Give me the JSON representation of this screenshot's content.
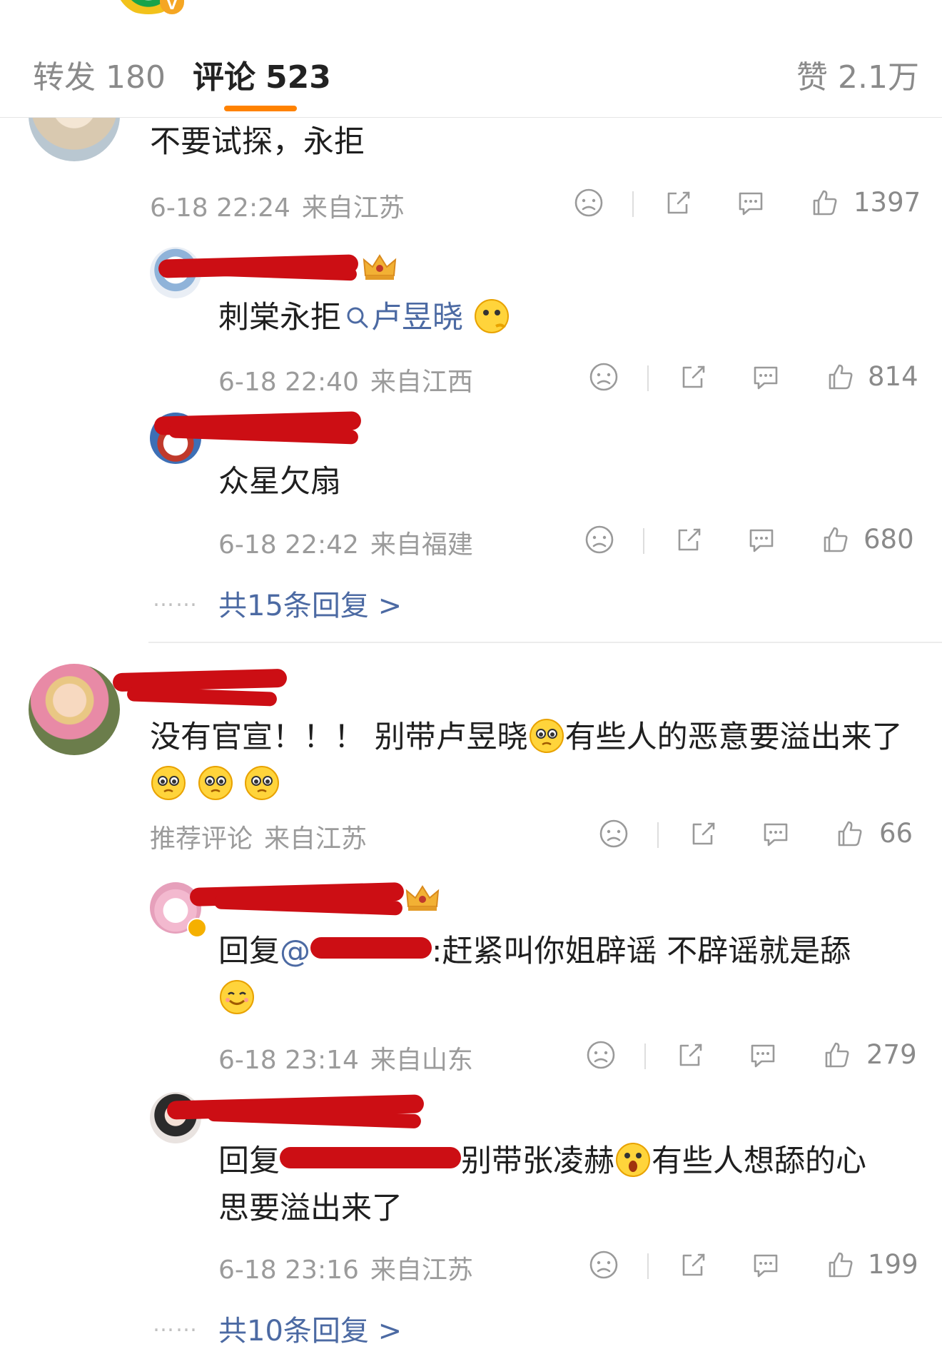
{
  "header": {
    "tabs": [
      {
        "label": "转发",
        "count": "180"
      },
      {
        "label": "评论",
        "count": "523"
      }
    ],
    "likes": {
      "label": "赞",
      "count": "2.1万"
    }
  },
  "comments": [
    {
      "text": "不要试探，永拒",
      "time": "6-18 22:24",
      "location": "来自江苏",
      "likes": "1397",
      "replies": [
        {
          "text_prefix": "刺棠永拒",
          "link": "卢昱晓",
          "time": "6-18 22:40",
          "location": "来自江西",
          "likes": "814"
        },
        {
          "text": "众星欠扇",
          "time": "6-18 22:42",
          "location": "来自福建",
          "likes": "680"
        }
      ],
      "more": "共15条回复 >"
    },
    {
      "text_line1": "没有官宣！！！ 别带卢昱晓",
      "text_line1_tail": "有些人的恶意要溢出来了",
      "tag": "推荐评论",
      "location": "来自江苏",
      "likes": "66",
      "replies": [
        {
          "prefix": "回复",
          "at": "@",
          "body": ":赶紧叫你姐辟谣 不辟谣就是舔",
          "time": "6-18 23:14",
          "location": "来自山东",
          "likes": "279"
        },
        {
          "prefix": "回复",
          "body": "别带张凌赫",
          "body_tail": "有些人想舔的心",
          "line2": "思要溢出来了",
          "time": "6-18 23:16",
          "location": "来自江苏",
          "likes": "199"
        }
      ],
      "more": "共10条回复 >"
    }
  ],
  "colors": {
    "accent": "#ff8200",
    "link": "#4c6aa3",
    "redaction": "#cc0e14"
  }
}
